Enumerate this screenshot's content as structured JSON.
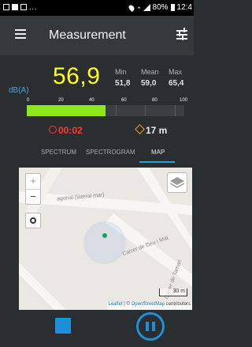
{
  "status_bar": {
    "dots": "...",
    "battery": "80%",
    "time": "12:4"
  },
  "app_bar": {
    "title": "Measurement",
    "menu_icon": "hamburger-menu-icon",
    "settings_icon": "tune-sliders-icon"
  },
  "meter": {
    "unit": "dB(A)",
    "current": "56,9",
    "labels": {
      "min": "Min",
      "mean": "Mean",
      "max": "Max"
    },
    "values": {
      "min": "51,8",
      "mean": "59,0",
      "max": "65,4"
    },
    "scale_ticks": [
      "0",
      "20",
      "40",
      "60",
      "80",
      "100"
    ],
    "level_fraction": 0.5,
    "bar_color": "#8ee71a",
    "value_color": "#ffff1a"
  },
  "info": {
    "elapsed": "00:02",
    "distance": "17 m",
    "timer_color": "#ff3b2f"
  },
  "tabs": [
    {
      "label": "SPECTRUM",
      "active": false
    },
    {
      "label": "SPECTROGRAM",
      "active": false
    },
    {
      "label": "MAP",
      "active": true
    }
  ],
  "map": {
    "zoom_in": "+",
    "zoom_out": "−",
    "streets": [
      "agonal (lateral mar)",
      "Carrer de Deu i Mat",
      "Carrer de Tamari"
    ],
    "scale_label": "30 m",
    "attribution": {
      "leaflet": "Leaflet",
      "separator": " | © ",
      "osm": "OpenStreetMap",
      "suffix": " contributors"
    }
  },
  "controls": {
    "stop_icon": "stop-square-icon",
    "pause_icon": "pause-circle-icon",
    "accent": "#1c8fd6"
  }
}
